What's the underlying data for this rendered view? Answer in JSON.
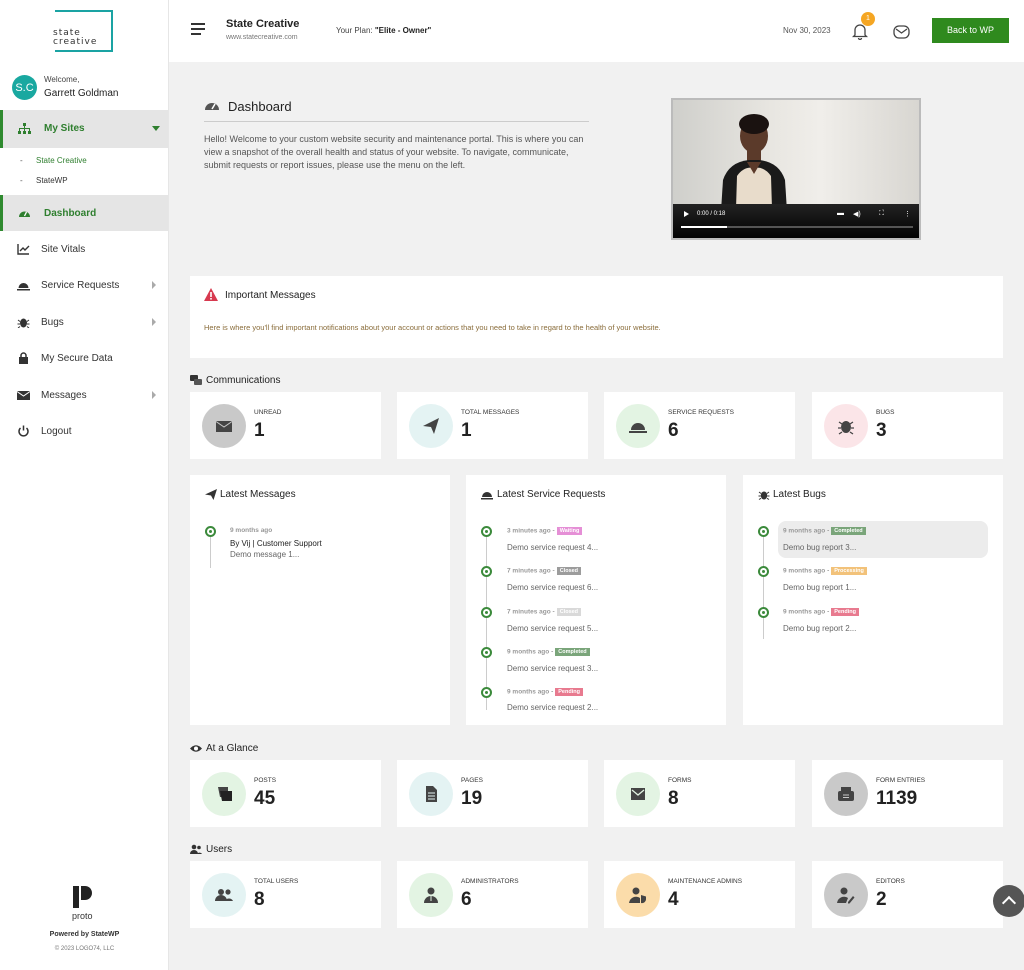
{
  "brand": {
    "logo_text": "state creative",
    "footer_logo_text": "proto",
    "powered": "Powered by StateWP",
    "copyright": "© 2023 LOGO74, LLC"
  },
  "user": {
    "initials": "S.C",
    "welcome": "Welcome,",
    "name": "Garrett Goldman"
  },
  "sidebar": {
    "my_sites_label": "My Sites",
    "sites": [
      "State Creative",
      "StateWP"
    ],
    "site_dash": "-",
    "items": [
      {
        "label": "Dashboard"
      },
      {
        "label": "Site Vitals"
      },
      {
        "label": "Service Requests"
      },
      {
        "label": "Bugs"
      },
      {
        "label": "My Secure Data"
      },
      {
        "label": "Messages"
      },
      {
        "label": "Logout"
      }
    ]
  },
  "topbar": {
    "site_name": "State Creative",
    "site_url": "www.statecreative.com",
    "plan_label": "Your Plan:",
    "plan_value": "\"Elite - Owner\"",
    "date": "Nov 30, 2023",
    "notification_count": "1",
    "back_button": "Back to WP"
  },
  "dashboard": {
    "title": "Dashboard",
    "intro": "Hello! Welcome to your custom website security and maintenance portal. This is where you can view a snapshot of the overall health and status of your website. To navigate, communicate, submit requests or report issues, please use the menu on the left.",
    "video_time": "0:00 / 0:18",
    "video_progress": 0.2
  },
  "important": {
    "title": "Important Messages",
    "text": "Here is where you'll find important notifications about your account or actions that you need to take in regard to the health of your website."
  },
  "communications": {
    "title": "Communications",
    "stats": [
      {
        "label": "UNREAD",
        "value": "1",
        "icon": "envelope-icon"
      },
      {
        "label": "TOTAL MESSAGES",
        "value": "1",
        "icon": "paper-plane-icon"
      },
      {
        "label": "SERVICE REQUESTS",
        "value": "6",
        "icon": "service-bell-icon"
      },
      {
        "label": "BUGS",
        "value": "3",
        "icon": "bug-icon"
      }
    ]
  },
  "latest_messages": {
    "title": "Latest Messages",
    "items": [
      {
        "time": "9 months ago",
        "author": "By Vij | Customer Support",
        "text": "Demo message 1..."
      }
    ]
  },
  "latest_requests": {
    "title": "Latest Service Requests",
    "separator": "-",
    "items": [
      {
        "time": "3 minutes ago",
        "status": "Waiting",
        "text": "Demo service request 4..."
      },
      {
        "time": "7 minutes ago",
        "status": "Closed",
        "text": "Demo service request 6..."
      },
      {
        "time": "7 minutes ago",
        "status": "Closed",
        "text": "Demo service request 5..."
      },
      {
        "time": "9 months ago",
        "status": "Completed",
        "text": "Demo service request 3..."
      },
      {
        "time": "9 months ago",
        "status": "Pending",
        "text": "Demo service request 2..."
      }
    ]
  },
  "latest_bugs": {
    "title": "Latest Bugs",
    "separator": "-",
    "items": [
      {
        "time": "9 months ago",
        "status": "Completed",
        "text": "Demo bug report 3..."
      },
      {
        "time": "9 months ago",
        "status": "Processing",
        "text": "Demo bug report 1..."
      },
      {
        "time": "9 months ago",
        "status": "Pending",
        "text": "Demo bug report 2..."
      }
    ]
  },
  "glance": {
    "title": "At a Glance",
    "stats": [
      {
        "label": "POSTS",
        "value": "45",
        "icon": "posts-icon"
      },
      {
        "label": "PAGES",
        "value": "19",
        "icon": "page-icon"
      },
      {
        "label": "FORMS",
        "value": "8",
        "icon": "form-envelope-icon"
      },
      {
        "label": "FORM ENTRIES",
        "value": "1139",
        "icon": "inbox-icon"
      }
    ]
  },
  "users": {
    "title": "Users",
    "stats": [
      {
        "label": "TOTAL USERS",
        "value": "8",
        "icon": "users-icon"
      },
      {
        "label": "ADMINISTRATORS",
        "value": "6",
        "icon": "admin-user-icon"
      },
      {
        "label": "MAINTENANCE ADMINS",
        "value": "4",
        "icon": "user-shield-icon"
      },
      {
        "label": "EDITORS",
        "value": "2",
        "icon": "user-edit-icon"
      }
    ]
  },
  "colors": {
    "accent": "#2f8a2f",
    "teal": "#1aa3a3",
    "waiting": "#e58fd6",
    "closed": "#9c9c9c",
    "completed": "#7aa57a",
    "pending": "#e87a8f",
    "processing": "#f2c27a"
  }
}
